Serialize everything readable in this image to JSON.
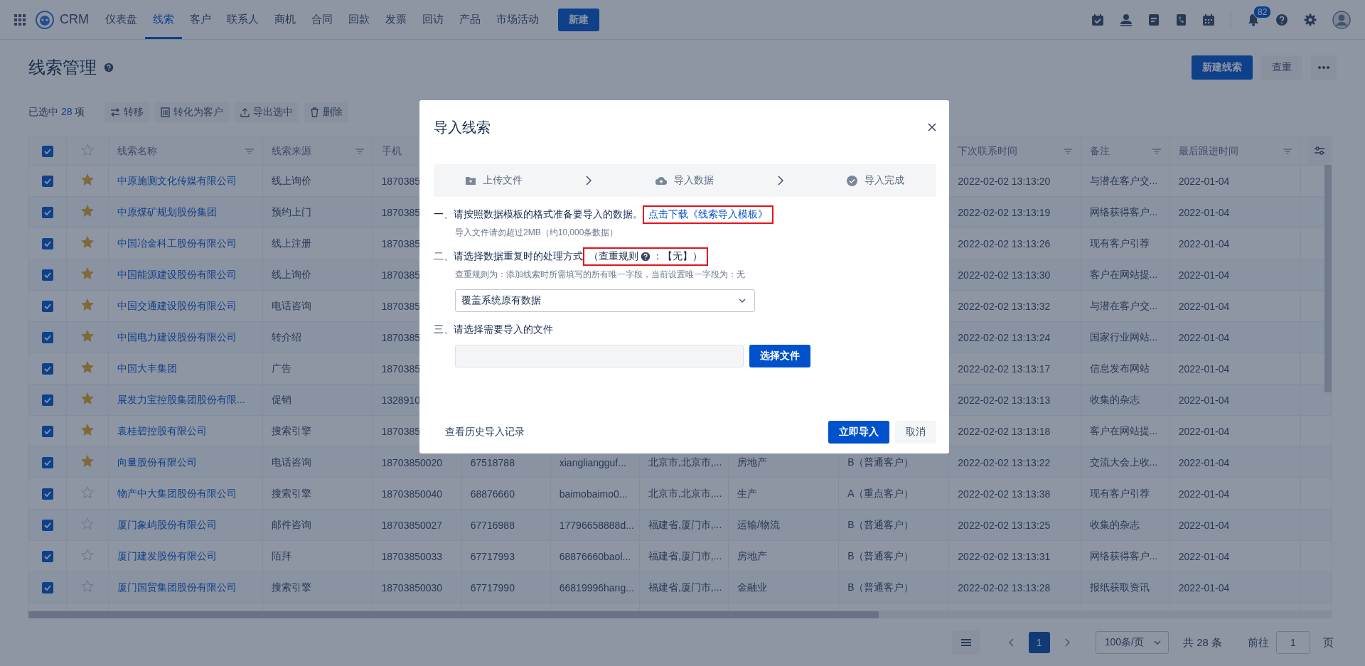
{
  "topbar": {
    "brand": "CRM",
    "nav": [
      {
        "label": "仪表盘",
        "selected": false
      },
      {
        "label": "线索",
        "selected": true
      },
      {
        "label": "客户",
        "selected": false
      },
      {
        "label": "联系人",
        "selected": false
      },
      {
        "label": "商机",
        "selected": false
      },
      {
        "label": "合同",
        "selected": false
      },
      {
        "label": "回款",
        "selected": false
      },
      {
        "label": "发票",
        "selected": false
      },
      {
        "label": "回访",
        "selected": false
      },
      {
        "label": "产品",
        "selected": false
      },
      {
        "label": "市场活动",
        "selected": false
      }
    ],
    "new_button": "新建",
    "notification_count": "82"
  },
  "page": {
    "title": "线索管理",
    "primary_action": "新建线索",
    "secondary_action": "查重"
  },
  "toolbar": {
    "selected_prefix": "已选中",
    "selected_count": "28",
    "selected_suffix": "项",
    "actions": [
      {
        "kind": "transfer",
        "label": "转移"
      },
      {
        "kind": "convert",
        "label": "转化为客户"
      },
      {
        "kind": "export",
        "label": "导出选中"
      },
      {
        "kind": "delete",
        "label": "删除"
      }
    ]
  },
  "table": {
    "all_checked": true,
    "headers": {
      "name": "线索名称",
      "source": "线索来源",
      "phone": "手机",
      "next_contact": "下次联系时间",
      "note": "备注",
      "last_followup": "最后跟进时间"
    },
    "rows": [
      {
        "checked": true,
        "starred": true,
        "name": "中原施测文化传媒有限公司",
        "source": "线上询价",
        "phone": "1870385",
        "next_contact": "2022-02-02 13:13:20",
        "note": "与潜在客户交...",
        "last_followup": "2022-01-04"
      },
      {
        "checked": true,
        "starred": true,
        "name": "中原煤矿规划股份集团",
        "source": "预约上门",
        "phone": "1870385",
        "next_contact": "2022-02-02 13:13:19",
        "note": "网络获得客户...",
        "last_followup": "2022-01-04"
      },
      {
        "checked": true,
        "starred": true,
        "name": "中国冶金科工股份有限公司",
        "source": "线上注册",
        "phone": "1870385",
        "next_contact": "2022-02-02 13:13:26",
        "note": "现有客户引荐",
        "last_followup": "2022-01-04"
      },
      {
        "checked": true,
        "starred": true,
        "name": "中国能源建设股份有限公司",
        "source": "线上询价",
        "phone": "1870385",
        "next_contact": "2022-02-02 13:13:30",
        "note": "客户在网站提...",
        "last_followup": "2022-01-04"
      },
      {
        "checked": true,
        "starred": true,
        "name": "中国交通建设股份有限公司",
        "source": "电话咨询",
        "phone": "1870385",
        "next_contact": "2022-02-02 13:13:32",
        "note": "与潜在客户交...",
        "last_followup": "2022-01-04"
      },
      {
        "checked": true,
        "starred": true,
        "name": "中国电力建设股份有限公司",
        "source": "转介绍",
        "phone": "1870385",
        "next_contact": "2022-02-02 13:13:24",
        "note": "国家行业网站...",
        "last_followup": "2022-01-04"
      },
      {
        "checked": true,
        "starred": true,
        "name": "中国大丰集团",
        "source": "广告",
        "phone": "1870385",
        "next_contact": "2022-02-02 13:13:17",
        "note": "信息发布网站",
        "last_followup": "2022-01-04"
      },
      {
        "checked": true,
        "starred": true,
        "name": "展发力宝控股集团股份有限...",
        "source": "促销",
        "phone": "1328910",
        "next_contact": "2022-02-02 13:13:13",
        "note": "收集的杂志",
        "last_followup": "2022-01-04"
      },
      {
        "checked": true,
        "starred": true,
        "name": "袁桂碧控股有限公司",
        "source": "搜索引擎",
        "phone": "1870385",
        "next_contact": "2022-02-02 13:13:18",
        "note": "客户在网站提...",
        "last_followup": "2022-01-04"
      },
      {
        "checked": true,
        "starred": true,
        "name": "向量股份有限公司",
        "source": "电话咨询",
        "phone": "18703850020",
        "column_6": "67518788",
        "column_7": "xiangliangguf...",
        "column_8": "北京市,北京市,...",
        "column_9": "房地产",
        "column_10": "B（普通客户）",
        "next_contact": "2022-02-02 13:13:22",
        "note": "交流大会上收...",
        "last_followup": "2022-01-04"
      },
      {
        "checked": true,
        "starred": false,
        "name": "物产中大集团股份有限公司",
        "source": "搜索引擎",
        "phone": "18703850040",
        "column_6": "68876660",
        "column_7": "baimobaimo0...",
        "column_8": "北京市,北京市,...",
        "column_9": "生产",
        "column_10": "A（重点客户）",
        "next_contact": "2022-02-02 13:13:38",
        "note": "现有客户引荐",
        "last_followup": "2022-01-04"
      },
      {
        "checked": true,
        "starred": false,
        "name": "厦门象屿股份有限公司",
        "source": "邮件咨询",
        "phone": "18703850027",
        "column_6": "67716988",
        "column_7": "17796658888d...",
        "column_8": "福建省,厦门市,...",
        "column_9": "运输/物流",
        "column_10": "B（普通客户）",
        "next_contact": "2022-02-02 13:13:25",
        "note": "收集的杂志",
        "last_followup": "2022-01-04"
      },
      {
        "checked": true,
        "starred": false,
        "name": "厦门建发股份有限公司",
        "source": "陌拜",
        "phone": "18703850033",
        "column_6": "67717993",
        "column_7": "68876660baol...",
        "column_8": "福建省,厦门市,...",
        "column_9": "房地产",
        "column_10": "B（普通客户）",
        "next_contact": "2022-02-02 13:13:31",
        "note": "网络获得客户...",
        "last_followup": "2022-01-04"
      },
      {
        "checked": true,
        "starred": false,
        "name": "厦门国贸集团股份有限公司",
        "source": "搜索引擎",
        "phone": "18703850030",
        "column_6": "67717990",
        "column_7": "66819996hang...",
        "column_8": "福建省,厦门市,...",
        "column_9": "金融业",
        "column_10": "B（普通客户）",
        "next_contact": "2022-02-02 13:13:28",
        "note": "报纸获取资讯",
        "last_followup": "2022-01-04"
      }
    ]
  },
  "pagination": {
    "pages": [
      {
        "label": "1",
        "selected": true
      }
    ],
    "page_size": "100条/页",
    "total": "共 28 条",
    "goto_label": "前往",
    "goto_value": "1",
    "goto_suffix": "页"
  },
  "dialog": {
    "title": "导入线索",
    "steps": [
      {
        "kind": "upload",
        "label": "上传文件"
      },
      {
        "kind": "import",
        "label": "导入数据"
      },
      {
        "kind": "done",
        "label": "导入完成"
      }
    ],
    "step1": {
      "text": "一、请按照数据模板的格式准备要导入的数据。",
      "link": "点击下载《线索导入模板》",
      "highlighted": true,
      "hint": "导入文件请勿超过2MB（约10,000条数据）"
    },
    "step2": {
      "text": "二、请选择数据重复时的处理方式",
      "rule_prefix": "（查重规则",
      "rule_suffix": "：【无】）",
      "highlighted": true,
      "hint": "查重规则为：添加线索时所需填写的所有唯一字段，当前设置唯一字段为：无",
      "select_value": "覆盖系统原有数据"
    },
    "step3": {
      "text": "三、请选择需要导入的文件",
      "choose_button": "选择文件"
    },
    "history_link": "查看历史导入记录",
    "confirm": "立即导入",
    "cancel": "取消"
  }
}
